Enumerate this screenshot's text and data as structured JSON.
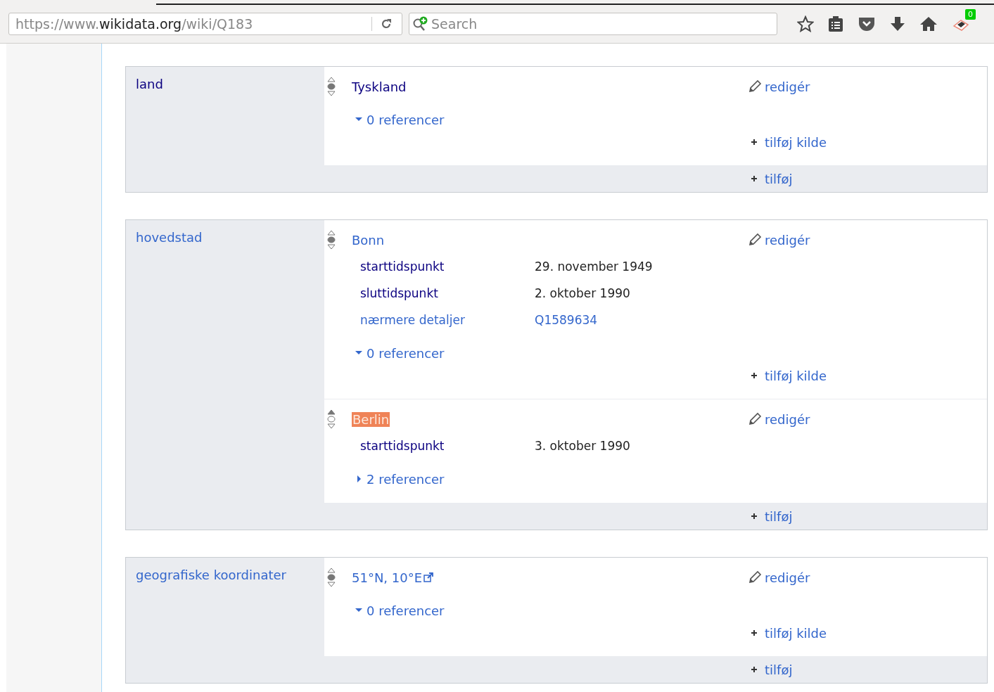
{
  "browser": {
    "url": {
      "prefix": "https://www.",
      "domain": "wikidata.org",
      "path": "/wiki/Q183"
    },
    "search": {
      "placeholder": "Search"
    },
    "badge": "0"
  },
  "groups": [
    {
      "property": "land",
      "visited": true,
      "statements": [
        {
          "value": "Tyskland",
          "visited": true,
          "preferred": false,
          "highlighted": false,
          "external": false,
          "edit": "redigér",
          "references": {
            "label": "0 referencer",
            "expanded": true
          },
          "add_source": "tilføj kilde"
        }
      ],
      "add": "tilføj"
    },
    {
      "property": "hovedstad",
      "visited": false,
      "statements": [
        {
          "value": "Bonn",
          "visited": false,
          "preferred": false,
          "highlighted": false,
          "external": false,
          "edit": "redigér",
          "qualifiers": [
            {
              "property": "starttidspunkt",
              "visited": true,
              "value": "29. november 1949",
              "kind": "time"
            },
            {
              "property": "sluttidspunkt",
              "visited": true,
              "value": "2. oktober 1990",
              "kind": "time"
            },
            {
              "property": "nærmere detaljer",
              "visited": false,
              "value": "Q1589634",
              "kind": "item"
            }
          ],
          "references": {
            "label": "0 referencer",
            "expanded": true
          },
          "add_source": "tilføj kilde"
        },
        {
          "value": "Berlin",
          "visited": false,
          "preferred": true,
          "highlighted": true,
          "external": false,
          "edit": "redigér",
          "qualifiers": [
            {
              "property": "starttidspunkt",
              "visited": true,
              "value": "3. oktober 1990",
              "kind": "time"
            }
          ],
          "references": {
            "label": "2 referencer",
            "expanded": false
          }
        }
      ],
      "add": "tilføj"
    },
    {
      "property": "geografiske koordinater",
      "visited": false,
      "statements": [
        {
          "value": "51°N, 10°E",
          "visited": false,
          "preferred": false,
          "highlighted": false,
          "external": true,
          "edit": "redigér",
          "references": {
            "label": "0 referencer",
            "expanded": true
          },
          "add_source": "tilføj kilde"
        }
      ],
      "add": "tilføj"
    }
  ]
}
